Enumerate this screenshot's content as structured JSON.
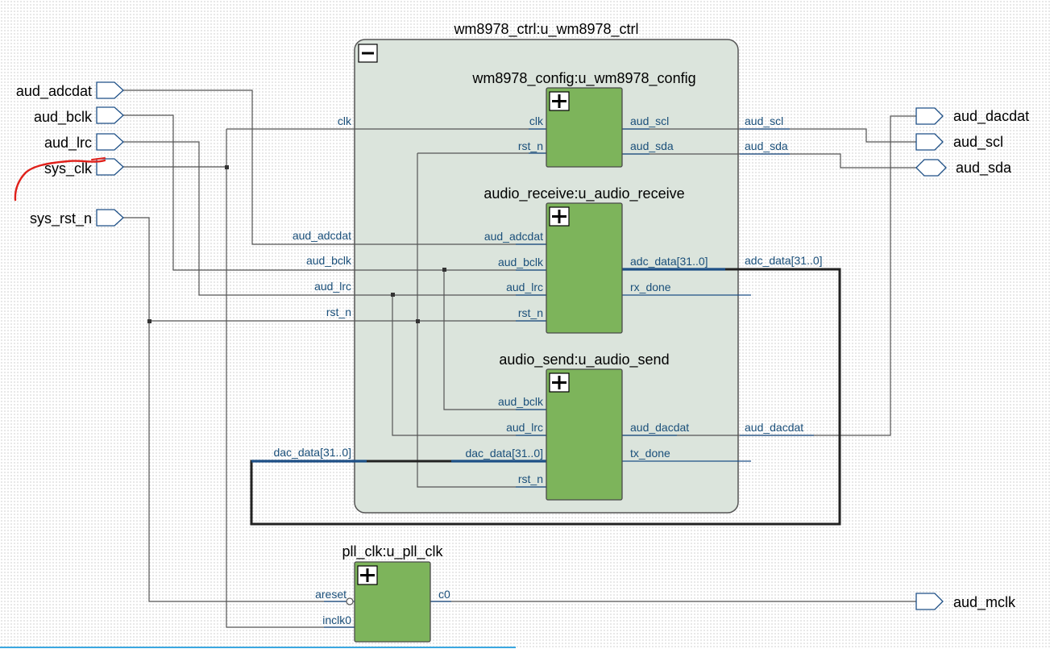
{
  "top": {
    "title": "wm8978_ctrl:u_wm8978_ctrl",
    "collapse_icon": "minus-icon",
    "fill": "#dbe4dc"
  },
  "inputs": {
    "aud_adcdat": "aud_adcdat",
    "aud_bclk": "aud_bclk",
    "aud_lrc": "aud_lrc",
    "sys_clk": "sys_clk",
    "sys_rst_n": "sys_rst_n"
  },
  "outputs": {
    "aud_dacdat": "aud_dacdat",
    "aud_scl": "aud_scl",
    "aud_sda": "aud_sda",
    "aud_mclk": "aud_mclk"
  },
  "signals": {
    "clk": "clk",
    "aud_adcdat": "aud_adcdat",
    "aud_bclk": "aud_bclk",
    "aud_lrc": "aud_lrc",
    "rst_n": "rst_n",
    "dac_data": "dac_data[31..0]",
    "aud_scl": "aud_scl",
    "aud_sda": "aud_sda",
    "adc_data": "adc_data[31..0]",
    "aud_dacdat": "aud_dacdat"
  },
  "config": {
    "title": "wm8978_config:u_wm8978_config",
    "in_ports": [
      "clk",
      "rst_n"
    ],
    "out_ports": [
      "aud_scl",
      "aud_sda"
    ]
  },
  "receive": {
    "title": "audio_receive:u_audio_receive",
    "in_ports": [
      "aud_adcdat",
      "aud_bclk",
      "aud_lrc",
      "rst_n"
    ],
    "out_ports": [
      "adc_data[31..0]",
      "rx_done"
    ]
  },
  "send": {
    "title": "audio_send:u_audio_send",
    "in_ports": [
      "aud_bclk",
      "aud_lrc",
      "dac_data[31..0]",
      "rst_n"
    ],
    "out_ports": [
      "aud_dacdat",
      "tx_done"
    ]
  },
  "pll": {
    "title": "pll_clk:u_pll_clk",
    "in_ports": [
      "areset",
      "inclk0"
    ],
    "out_ports": [
      "c0"
    ]
  },
  "block_fill": "#7db45b",
  "label_color": "#1a4f7a",
  "annotation_color": "#e0201a"
}
